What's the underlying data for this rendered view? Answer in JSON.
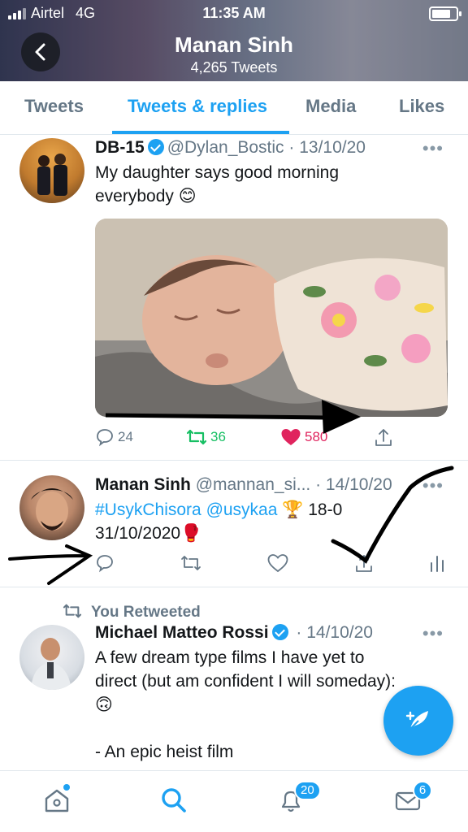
{
  "status_bar": {
    "carrier": "Airtel",
    "network": "4G",
    "time": "11:35 AM"
  },
  "header": {
    "name": "Manan Sinh",
    "tweet_count": "4,265 Tweets"
  },
  "tabs": [
    {
      "label": "Tweets"
    },
    {
      "label": "Tweets & replies"
    },
    {
      "label": "Media"
    },
    {
      "label": "Likes"
    }
  ],
  "tweets": [
    {
      "name": "DB-15",
      "handle": "@Dylan_Bostic",
      "date": "13/10/20",
      "text_line1": "My daughter says good morning",
      "text_line2": "everybody 😊",
      "replies": "24",
      "retweets": "36",
      "likes": "580"
    },
    {
      "name": "Manan Sinh",
      "handle": "@mannan_si...",
      "date": "14/10/20",
      "link1": "#UsykChisora",
      "link2": "@usykaa",
      "text_after_links": "🏆 18-0",
      "text_line2": "31/10/2020🥊"
    },
    {
      "retweet_label": "You Retweeted",
      "name": "Michael Matteo Rossi",
      "date": "14/10/20",
      "text_line1": "A few dream type films I have yet to",
      "text_line2": "direct (but am confident I will someday):",
      "text_line3": "🙃",
      "text_line4": "- An epic heist film"
    }
  ],
  "bottom_nav": {
    "notifications_badge": "20",
    "messages_badge": "6"
  },
  "colors": {
    "accent": "#1da1f2",
    "retweet": "#17bf63",
    "like": "#e0245e"
  }
}
